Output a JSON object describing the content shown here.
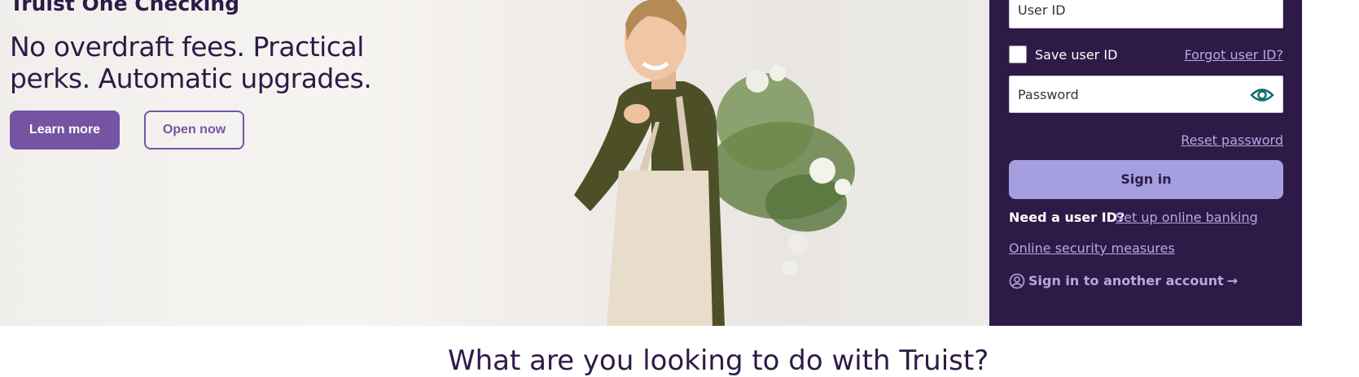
{
  "hero": {
    "eyebrow": "Truist One Checking",
    "headline": "No overdraft fees. Practical perks. Automatic upgrades.",
    "primary_button": "Learn more",
    "secondary_button": "Open now"
  },
  "login": {
    "user_id_placeholder": "User ID",
    "save_user_id_label": "Save user ID",
    "forgot_user_id": "Forgot user ID?",
    "password_placeholder": "Password",
    "reset_password": "Reset password",
    "sign_in": "Sign in",
    "need_user_id": "Need a user ID?",
    "set_up_online_banking": "Set up online banking",
    "online_security_measures": "Online security measures",
    "sign_in_another": "Sign in to another account"
  },
  "section_heading_partial": "What are you looking to do with Truist?",
  "colors": {
    "brand_purple": "#2e1a47",
    "accent_purple": "#7454a3",
    "link_lavender": "#b9a6e3",
    "signin_button": "#a59fe0",
    "eye_icon_teal": "#0f6d6b"
  },
  "icons": {
    "password_toggle": "eye-icon",
    "account": "user-circle-icon",
    "arrow": "arrow-right-icon"
  }
}
